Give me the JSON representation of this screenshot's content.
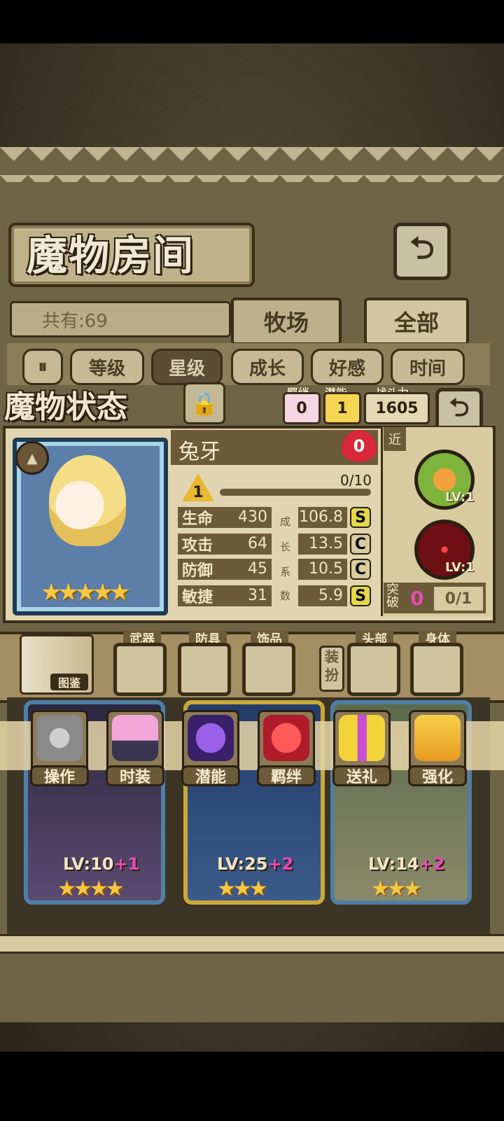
{
  "header": {
    "title": "魔物房间",
    "back_icon": "return-arrow-icon"
  },
  "filter": {
    "count_text": "共有:69",
    "tabs": [
      "牧场",
      "全部"
    ]
  },
  "sort": {
    "buttons": [
      "等级",
      "星级",
      "成长",
      "好感",
      "时间"
    ],
    "selected": "星级"
  },
  "status": {
    "section_title": "魔物状态",
    "bond": {
      "label": "羁绊",
      "value": "0"
    },
    "potential": {
      "label": "潜能",
      "value": "1"
    },
    "power": {
      "label": "战斗力",
      "value": "1605"
    },
    "name": "兔牙",
    "affection": "0",
    "level": "1",
    "exp": "0/10",
    "stars": "★★★★★",
    "stats": [
      {
        "label": "生命",
        "value": "430",
        "growth": "106.8",
        "grade": "S"
      },
      {
        "label": "攻击",
        "value": "64",
        "growth": "13.5",
        "grade": "C"
      },
      {
        "label": "防御",
        "value": "45",
        "growth": "10.5",
        "grade": "C"
      },
      {
        "label": "敏捷",
        "value": "31",
        "growth": "5.9",
        "grade": "S"
      }
    ],
    "growth_coeff_label": [
      "成",
      "长",
      "系",
      "数"
    ],
    "range_tag": "近",
    "skills": [
      {
        "lv": "LV:1"
      },
      {
        "lv": "LV:1"
      }
    ],
    "breakthrough": {
      "label": "突破",
      "value": "0",
      "progress": "0/1"
    }
  },
  "equipment": {
    "codex_label": "图鉴",
    "slots": [
      "武器",
      "防具",
      "饰品"
    ],
    "dress_label": "装扮",
    "dress_slots": [
      "头部",
      "身体"
    ]
  },
  "actions": [
    "操作",
    "时装",
    "潜能",
    "羁绊",
    "送礼",
    "强化"
  ],
  "cards": [
    {
      "lv": "LV:10",
      "plus": "+1",
      "stars": "★★★★"
    },
    {
      "lv": "LV:25",
      "plus": "+2",
      "stars": "★★★"
    },
    {
      "lv": "LV:14",
      "plus": "+2",
      "stars": "★★★"
    }
  ]
}
